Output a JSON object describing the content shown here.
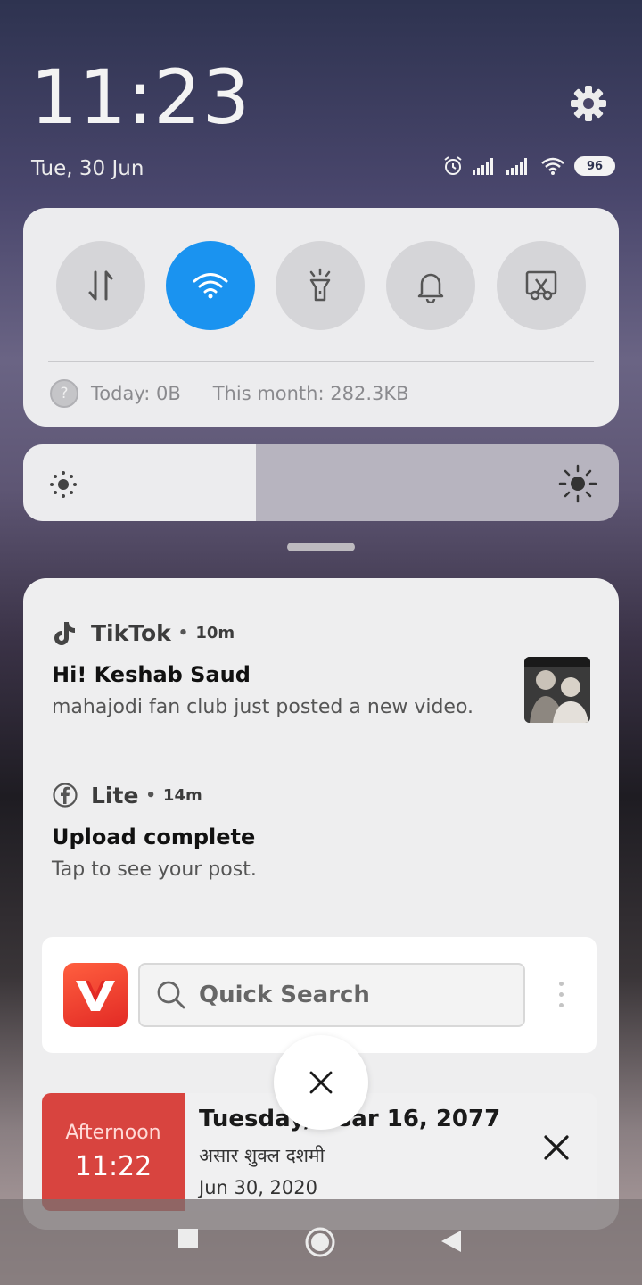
{
  "status_bar": {
    "time": "11:23",
    "date": "Tue, 30 Jun",
    "battery": "96"
  },
  "quick_settings": {
    "toggles": [
      {
        "name": "mobile-data",
        "active": false
      },
      {
        "name": "wifi",
        "active": true
      },
      {
        "name": "flashlight",
        "active": false
      },
      {
        "name": "sound",
        "active": false
      },
      {
        "name": "screenshot",
        "active": false
      }
    ],
    "data_usage": {
      "today": "Today: 0B",
      "this_month": "This month: 282.3KB",
      "help_icon": "?"
    },
    "brightness_level": 0.39
  },
  "notifications": [
    {
      "app": "TikTok",
      "time": "10m",
      "title": "Hi! Keshab Saud",
      "text": "mahajodi fan club just posted a new video."
    },
    {
      "app": "Lite",
      "time": "14m",
      "title": "Upload complete",
      "text": "Tap to see your post."
    }
  ],
  "quick_search": {
    "placeholder": "Quick Search"
  },
  "calendar": {
    "part_of_day": "Afternoon",
    "time": "11:22",
    "title": "Tuesday, Asar 16, 2077",
    "nepali_date": "असार शुक्ल दशमी",
    "gregorian_date": "Jun 30, 2020"
  },
  "colors": {
    "accent": "#1a93f0",
    "calendar_red": "#d8443f",
    "vid_logo": "#e22a25"
  }
}
